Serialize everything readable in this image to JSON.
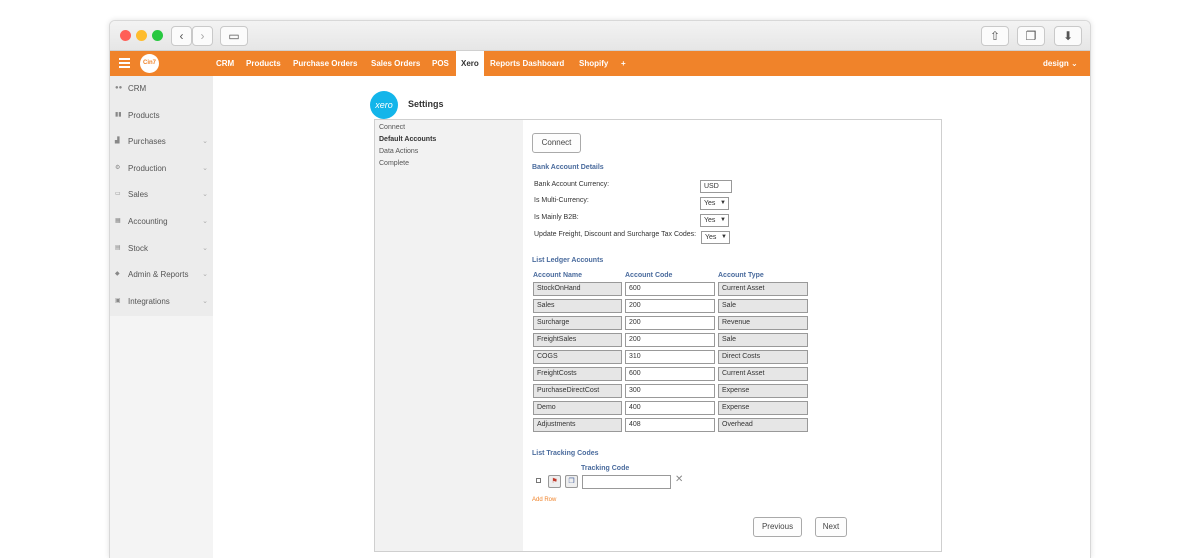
{
  "browser": {
    "colors": {
      "close": "#ff5f57",
      "minimize": "#febc2e",
      "maximize": "#28c840"
    }
  },
  "nav": {
    "logo": "Cin7",
    "items": [
      "CRM",
      "Products",
      "Purchase Orders",
      "Sales Orders",
      "POS",
      "Xero",
      "Reports Dashboard",
      "Shopify",
      "+"
    ],
    "active": "Xero",
    "user": "design ⌄",
    "accent": "#f0832a"
  },
  "sidebar": {
    "items": [
      {
        "label": "CRM",
        "icon": "users-icon"
      },
      {
        "label": "Products",
        "icon": "barcode-icon"
      },
      {
        "label": "Purchases",
        "icon": "cart-icon"
      },
      {
        "label": "Production",
        "icon": "gears-icon"
      },
      {
        "label": "Sales",
        "icon": "cash-icon"
      },
      {
        "label": "Accounting",
        "icon": "calculator-icon"
      },
      {
        "label": "Stock",
        "icon": "boxes-icon"
      },
      {
        "label": "Admin & Reports",
        "icon": "admin-icon"
      },
      {
        "label": "Integrations",
        "icon": "plug-icon"
      }
    ]
  },
  "header": {
    "logo": "xero",
    "title": "Settings"
  },
  "steps": [
    "Connect",
    "Default Accounts",
    "Data Actions",
    "Complete"
  ],
  "content": {
    "connect_label": "Connect",
    "bank_title": "Bank Account Details",
    "currency_label": "Bank Account Currency:",
    "currency_value": "USD",
    "multi_label": "Is Multi-Currency:",
    "multi_value": "Yes",
    "b2b_label": "Is Mainly B2B:",
    "b2b_value": "Yes",
    "freight_label": "Update Freight, Discount and Surcharge Tax Codes:",
    "freight_value": "Yes",
    "ledger_title": "List Ledger Accounts",
    "columns": [
      "Account Name",
      "Account Code",
      "Account Type"
    ],
    "rows": [
      [
        "StockOnHand",
        "600",
        "Current Asset"
      ],
      [
        "Sales",
        "200",
        "Sale"
      ],
      [
        "Surcharge",
        "200",
        "Revenue"
      ],
      [
        "FreightSales",
        "200",
        "Sale"
      ],
      [
        "COGS",
        "310",
        "Direct Costs"
      ],
      [
        "FreightCosts",
        "600",
        "Current Asset"
      ],
      [
        "PurchaseDirectCost",
        "300",
        "Expense"
      ],
      [
        "Demo",
        "400",
        "Expense"
      ],
      [
        "Adjustments",
        "408",
        "Overhead"
      ]
    ],
    "tracking_title": "List Tracking Codes",
    "tracking_col": "Tracking Code",
    "add_row": "Add Row",
    "previous": "Previous",
    "next": "Next"
  }
}
